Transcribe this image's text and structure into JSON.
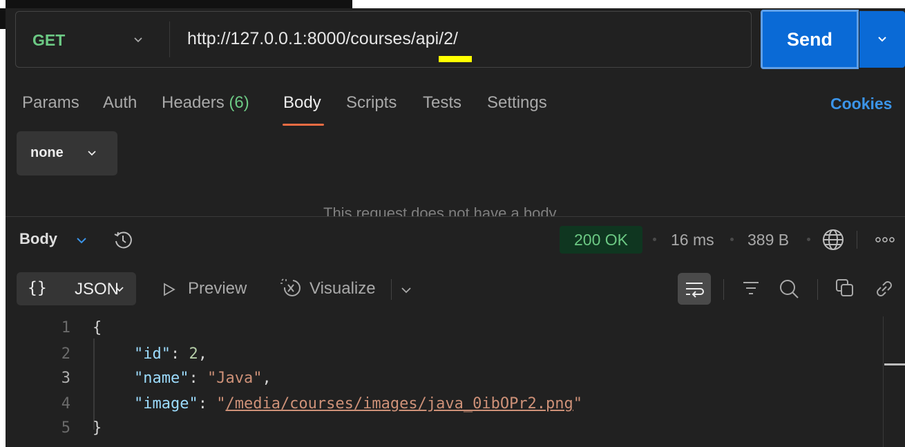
{
  "request": {
    "method": "GET",
    "url": "http://127.0.0.1:8000/courses/api/2/",
    "send_label": "Send"
  },
  "tabs": [
    {
      "label": "Params"
    },
    {
      "label": "Auth"
    },
    {
      "label": "Headers",
      "count": "(6)"
    },
    {
      "label": "Body",
      "active": true
    },
    {
      "label": "Scripts"
    },
    {
      "label": "Tests"
    },
    {
      "label": "Settings"
    }
  ],
  "cookies_label": "Cookies",
  "body_type": "none",
  "empty_body_message": "This request does not have a body",
  "response": {
    "section_label": "Body",
    "status": "200 OK",
    "time": "16 ms",
    "size": "389 B",
    "format": "JSON",
    "format_braces": "{}",
    "preview_label": "Preview",
    "visualize_label": "Visualize"
  },
  "code": {
    "line_numbers": [
      "1",
      "2",
      "3",
      "4",
      "5"
    ],
    "open_brace": "{",
    "close_brace": "}",
    "fields": [
      {
        "key": "\"id\"",
        "value": "2",
        "type": "number",
        "comma": ","
      },
      {
        "key": "\"name\"",
        "value": "\"Java\"",
        "type": "string",
        "comma": ","
      },
      {
        "key": "\"image\"",
        "value_open": "\"",
        "value_link": "/media/courses/images/java_0ibOPr2.png",
        "value_close": "\"",
        "type": "link",
        "comma": ""
      }
    ]
  },
  "colors": {
    "accent_send": "#0a6ad6",
    "method_get": "#6cc984",
    "status_ok": "#6cc984",
    "cookies": "#3b94e8",
    "active_tab_underline": "#ef6c43"
  }
}
